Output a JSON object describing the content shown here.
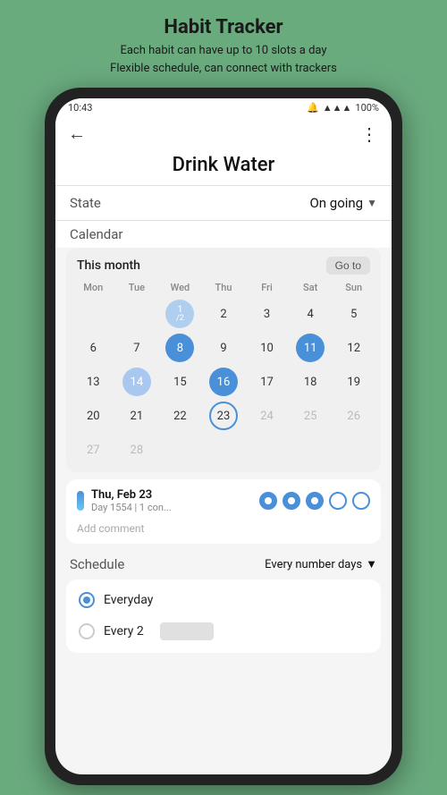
{
  "header": {
    "title": "Habit Tracker",
    "subtitle_line1": "Each habit can have up to 10 slots a day",
    "subtitle_line2": "Flexible schedule, can connect with trackers"
  },
  "status_bar": {
    "time": "10:43",
    "battery": "100%"
  },
  "nav": {
    "back_icon": "←",
    "more_icon": "⋮"
  },
  "page": {
    "title": "Drink Water"
  },
  "state_section": {
    "label": "State",
    "value": "On going"
  },
  "calendar_section": {
    "label": "Calendar",
    "month_label": "This month",
    "goto_label": "Go to",
    "day_headers": [
      "Mon",
      "Tue",
      "Wed",
      "Thu",
      "Fri",
      "Sat",
      "Sun"
    ],
    "rows": [
      [
        "",
        "",
        "1/2",
        "2",
        "3",
        "4",
        "5"
      ],
      [
        "6",
        "7",
        "8",
        "9",
        "10",
        "11",
        "12"
      ],
      [
        "13",
        "14",
        "15",
        "16",
        "17",
        "18",
        "19"
      ],
      [
        "20",
        "21",
        "22",
        "23",
        "24",
        "25",
        "26"
      ],
      [
        "27",
        "28",
        "",
        "",
        "",
        "",
        ""
      ]
    ],
    "cell_styles": {
      "8": "blue-full",
      "11": "blue-full",
      "14": "blue-partial",
      "16": "blue-full",
      "23": "today-border"
    }
  },
  "day_detail": {
    "date": "Thu, Feb 23",
    "sub": "Day 1554 | 1 con...",
    "dots": [
      "filled",
      "filled",
      "filled",
      "empty",
      "empty"
    ],
    "add_comment": "Add comment"
  },
  "schedule_section": {
    "label": "Schedule",
    "value": "Every number days",
    "options": [
      {
        "label": "Everyday",
        "selected": true
      },
      {
        "label": "Every 2",
        "selected": false
      }
    ]
  }
}
